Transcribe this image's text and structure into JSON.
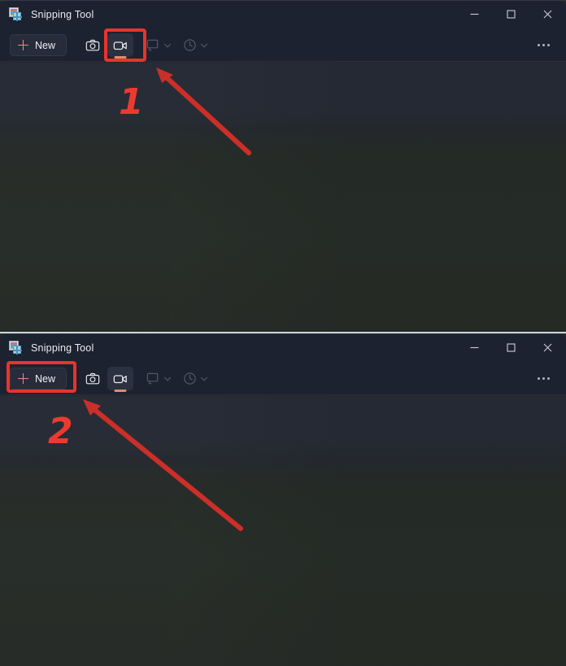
{
  "windows": [
    {
      "title": "Snipping Tool",
      "app_icon": "snipping-tool-icon",
      "controls": {
        "minimize": "minimize-icon",
        "maximize": "maximize-icon",
        "close": "close-icon"
      },
      "toolbar": {
        "new_label": "New",
        "new_icon": "plus-icon",
        "camera_icon": "camera-icon",
        "video_icon": "video-camera-icon",
        "snip_mode_icon": "rectangle-snip-icon",
        "snip_mode_chevron": "chevron-down-icon",
        "delay_icon": "clock-delay-icon",
        "delay_chevron": "chevron-down-icon",
        "more_icon": "ellipsis-icon",
        "selected_mode": "video",
        "highlighted_control": "video-camera-icon"
      }
    },
    {
      "title": "Snipping Tool",
      "app_icon": "snipping-tool-icon",
      "controls": {
        "minimize": "minimize-icon",
        "maximize": "maximize-icon",
        "close": "close-icon"
      },
      "toolbar": {
        "new_label": "New",
        "new_icon": "plus-icon",
        "camera_icon": "camera-icon",
        "video_icon": "video-camera-icon",
        "snip_mode_icon": "rectangle-snip-icon",
        "snip_mode_chevron": "chevron-down-icon",
        "delay_icon": "clock-delay-icon",
        "delay_chevron": "chevron-down-icon",
        "more_icon": "ellipsis-icon",
        "selected_mode": "video",
        "highlighted_control": "new-button"
      }
    }
  ],
  "annotations": [
    {
      "number": "1",
      "target": "video-camera-icon"
    },
    {
      "number": "2",
      "target": "new-button"
    }
  ],
  "colors": {
    "annotation_red": "#e8342c",
    "titlebar_bg": "#1d2230",
    "canvas_top": "#262a35",
    "canvas_bottom": "#262a26",
    "mode_underline": "#d98f6b",
    "plus_accent": "#e98a8a"
  }
}
